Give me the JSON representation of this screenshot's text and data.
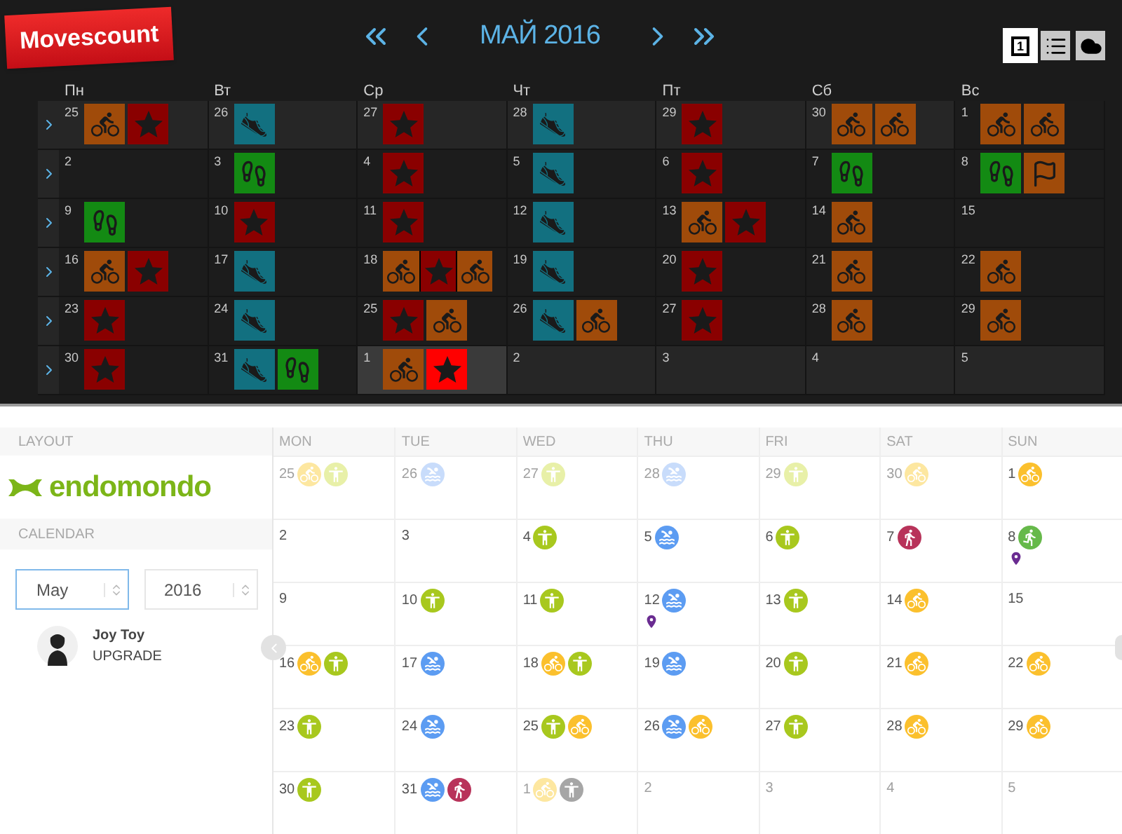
{
  "movescount": {
    "logo": "Movescount",
    "title": "МАЙ 2016",
    "views": [
      {
        "kind": "day",
        "label": "1",
        "selected": true
      },
      {
        "kind": "list",
        "selected": false
      },
      {
        "kind": "cloud",
        "selected": false
      }
    ],
    "weekdays": [
      "Пн",
      "Вт",
      "Ср",
      "Чт",
      "Пт",
      "Сб",
      "Вс"
    ],
    "weeks": [
      [
        {
          "day": "25",
          "kind": "other",
          "activities": [
            {
              "kind": "bike",
              "color": "#a04b0a"
            },
            {
              "kind": "star",
              "color": "#8a0000"
            }
          ]
        },
        {
          "day": "26",
          "kind": "other",
          "activities": [
            {
              "kind": "shoe",
              "color": "#127080"
            }
          ]
        },
        {
          "day": "27",
          "kind": "other",
          "activities": [
            {
              "kind": "star",
              "color": "#8a0000"
            }
          ]
        },
        {
          "day": "28",
          "kind": "other",
          "activities": [
            {
              "kind": "shoe",
              "color": "#127080"
            }
          ]
        },
        {
          "day": "29",
          "kind": "other",
          "activities": [
            {
              "kind": "star",
              "color": "#8a0000"
            }
          ]
        },
        {
          "day": "30",
          "kind": "other",
          "activities": [
            {
              "kind": "bike",
              "color": "#a04b0a"
            },
            {
              "kind": "bike",
              "color": "#a04b0a"
            }
          ]
        },
        {
          "day": "1",
          "kind": "current",
          "activities": [
            {
              "kind": "bike",
              "color": "#a04b0a"
            },
            {
              "kind": "bike",
              "color": "#a04b0a"
            }
          ]
        }
      ],
      [
        {
          "day": "2",
          "kind": "current"
        },
        {
          "day": "3",
          "kind": "current",
          "activities": [
            {
              "kind": "sole",
              "color": "#138a13"
            }
          ]
        },
        {
          "day": "4",
          "kind": "current",
          "activities": [
            {
              "kind": "star",
              "color": "#8a0000"
            }
          ]
        },
        {
          "day": "5",
          "kind": "current",
          "activities": [
            {
              "kind": "shoe",
              "color": "#127080"
            }
          ]
        },
        {
          "day": "6",
          "kind": "current",
          "activities": [
            {
              "kind": "star",
              "color": "#8a0000"
            }
          ]
        },
        {
          "day": "7",
          "kind": "current",
          "activities": [
            {
              "kind": "sole",
              "color": "#138a13"
            }
          ]
        },
        {
          "day": "8",
          "kind": "current",
          "activities": [
            {
              "kind": "sole",
              "color": "#138a13"
            },
            {
              "kind": "flag",
              "color": "#a04b0a"
            }
          ]
        }
      ],
      [
        {
          "day": "9",
          "kind": "current",
          "activities": [
            {
              "kind": "sole",
              "color": "#138a13"
            }
          ]
        },
        {
          "day": "10",
          "kind": "current",
          "activities": [
            {
              "kind": "star",
              "color": "#8a0000"
            }
          ]
        },
        {
          "day": "11",
          "kind": "current",
          "activities": [
            {
              "kind": "star",
              "color": "#8a0000"
            }
          ]
        },
        {
          "day": "12",
          "kind": "current",
          "activities": [
            {
              "kind": "shoe",
              "color": "#127080"
            }
          ]
        },
        {
          "day": "13",
          "kind": "current",
          "activities": [
            {
              "kind": "bike",
              "color": "#a04b0a"
            },
            {
              "kind": "star",
              "color": "#8a0000"
            }
          ]
        },
        {
          "day": "14",
          "kind": "current",
          "activities": [
            {
              "kind": "bike",
              "color": "#a04b0a"
            }
          ]
        },
        {
          "day": "15",
          "kind": "current"
        }
      ],
      [
        {
          "day": "16",
          "kind": "current",
          "activities": [
            {
              "kind": "bike",
              "color": "#a04b0a"
            },
            {
              "kind": "star",
              "color": "#8a0000"
            }
          ]
        },
        {
          "day": "17",
          "kind": "current",
          "activities": [
            {
              "kind": "shoe",
              "color": "#127080"
            }
          ]
        },
        {
          "day": "18",
          "kind": "current",
          "activities": [
            {
              "kind": "bike",
              "color": "#a04b0a"
            },
            {
              "kind": "star",
              "color": "#8a0000"
            },
            {
              "kind": "bike",
              "color": "#a04b0a"
            }
          ]
        },
        {
          "day": "19",
          "kind": "current",
          "activities": [
            {
              "kind": "shoe",
              "color": "#127080"
            }
          ]
        },
        {
          "day": "20",
          "kind": "current",
          "activities": [
            {
              "kind": "star",
              "color": "#8a0000"
            }
          ]
        },
        {
          "day": "21",
          "kind": "current",
          "activities": [
            {
              "kind": "bike",
              "color": "#a04b0a"
            }
          ]
        },
        {
          "day": "22",
          "kind": "current",
          "activities": [
            {
              "kind": "bike",
              "color": "#a04b0a"
            }
          ]
        }
      ],
      [
        {
          "day": "23",
          "kind": "current",
          "activities": [
            {
              "kind": "star",
              "color": "#8a0000"
            }
          ]
        },
        {
          "day": "24",
          "kind": "current",
          "activities": [
            {
              "kind": "shoe",
              "color": "#127080"
            }
          ]
        },
        {
          "day": "25",
          "kind": "current",
          "activities": [
            {
              "kind": "star",
              "color": "#8a0000"
            },
            {
              "kind": "bike",
              "color": "#a04b0a"
            }
          ]
        },
        {
          "day": "26",
          "kind": "current",
          "activities": [
            {
              "kind": "shoe",
              "color": "#127080"
            },
            {
              "kind": "bike",
              "color": "#a04b0a"
            }
          ]
        },
        {
          "day": "27",
          "kind": "current",
          "activities": [
            {
              "kind": "star",
              "color": "#8a0000"
            }
          ]
        },
        {
          "day": "28",
          "kind": "current",
          "activities": [
            {
              "kind": "bike",
              "color": "#a04b0a"
            }
          ]
        },
        {
          "day": "29",
          "kind": "current",
          "activities": [
            {
              "kind": "bike",
              "color": "#a04b0a"
            }
          ]
        }
      ],
      [
        {
          "day": "30",
          "kind": "current",
          "activities": [
            {
              "kind": "star",
              "color": "#8a0000"
            }
          ]
        },
        {
          "day": "31",
          "kind": "current",
          "activities": [
            {
              "kind": "shoe",
              "color": "#127080"
            },
            {
              "kind": "sole",
              "color": "#138a13"
            }
          ]
        },
        {
          "day": "1",
          "kind": "today",
          "activities": [
            {
              "kind": "bike",
              "color": "#a04b0a"
            },
            {
              "kind": "star",
              "color": "#ff0000"
            }
          ]
        },
        {
          "day": "2",
          "kind": "other"
        },
        {
          "day": "3",
          "kind": "other"
        },
        {
          "day": "4",
          "kind": "other"
        },
        {
          "day": "5",
          "kind": "other"
        }
      ]
    ]
  },
  "endomondo": {
    "sidebar": {
      "layout_heading": "LAYOUT",
      "logo": "endomondo",
      "calendar_heading": "CALENDAR",
      "month": "May",
      "year": "2016",
      "user": {
        "name": "Joy Toy",
        "action": "UPGRADE"
      }
    },
    "weekdays": [
      "MON",
      "TUE",
      "WED",
      "THU",
      "FRI",
      "SAT",
      "SUN"
    ],
    "weeks": [
      [
        {
          "day": "25",
          "other_month": true,
          "pin": false,
          "activities": [
            {
              "kind": "bike",
              "color": "#fde7a0"
            },
            {
              "kind": "fitness",
              "color": "#e8f0a8"
            }
          ]
        },
        {
          "day": "26",
          "other_month": true,
          "pin": false,
          "activities": [
            {
              "kind": "swim",
              "color": "#c8dcfb"
            }
          ]
        },
        {
          "day": "27",
          "other_month": true,
          "pin": false,
          "activities": [
            {
              "kind": "fitness",
              "color": "#e8f0a8"
            }
          ]
        },
        {
          "day": "28",
          "other_month": true,
          "pin": false,
          "activities": [
            {
              "kind": "swim",
              "color": "#c8dcfb"
            }
          ]
        },
        {
          "day": "29",
          "other_month": true,
          "pin": false,
          "activities": [
            {
              "kind": "fitness",
              "color": "#e8f0a8"
            }
          ]
        },
        {
          "day": "30",
          "other_month": true,
          "pin": false,
          "activities": [
            {
              "kind": "bike",
              "color": "#fde7a0"
            }
          ]
        },
        {
          "day": "1",
          "other_month": false,
          "pin": false,
          "activities": [
            {
              "kind": "bike",
              "color": "#fbc02d"
            }
          ]
        }
      ],
      [
        {
          "day": "2",
          "other_month": false,
          "pin": false
        },
        {
          "day": "3",
          "other_month": false,
          "pin": false
        },
        {
          "day": "4",
          "other_month": false,
          "pin": false,
          "activities": [
            {
              "kind": "fitness",
              "color": "#a8c81e"
            }
          ]
        },
        {
          "day": "5",
          "other_month": false,
          "pin": false,
          "activities": [
            {
              "kind": "swim",
              "color": "#5c9cf2"
            }
          ]
        },
        {
          "day": "6",
          "other_month": false,
          "pin": false,
          "activities": [
            {
              "kind": "fitness",
              "color": "#a8c81e"
            }
          ]
        },
        {
          "day": "7",
          "other_month": false,
          "pin": false,
          "activities": [
            {
              "kind": "walk",
              "color": "#b8335a"
            }
          ]
        },
        {
          "day": "8",
          "other_month": false,
          "pin": true,
          "activities": [
            {
              "kind": "run",
              "color": "#66b94a"
            }
          ]
        }
      ],
      [
        {
          "day": "9",
          "other_month": false,
          "pin": false
        },
        {
          "day": "10",
          "other_month": false,
          "pin": false,
          "activities": [
            {
              "kind": "fitness",
              "color": "#a8c81e"
            }
          ]
        },
        {
          "day": "11",
          "other_month": false,
          "pin": false,
          "activities": [
            {
              "kind": "fitness",
              "color": "#a8c81e"
            }
          ]
        },
        {
          "day": "12",
          "other_month": false,
          "pin": true,
          "activities": [
            {
              "kind": "swim",
              "color": "#5c9cf2"
            }
          ]
        },
        {
          "day": "13",
          "other_month": false,
          "pin": false,
          "activities": [
            {
              "kind": "fitness",
              "color": "#a8c81e"
            }
          ]
        },
        {
          "day": "14",
          "other_month": false,
          "pin": false,
          "activities": [
            {
              "kind": "bike",
              "color": "#fbc02d"
            }
          ]
        },
        {
          "day": "15",
          "other_month": false,
          "pin": false
        }
      ],
      [
        {
          "day": "16",
          "other_month": false,
          "pin": false,
          "activities": [
            {
              "kind": "bike",
              "color": "#fbc02d"
            },
            {
              "kind": "fitness",
              "color": "#a8c81e"
            }
          ]
        },
        {
          "day": "17",
          "other_month": false,
          "pin": false,
          "activities": [
            {
              "kind": "swim",
              "color": "#5c9cf2"
            }
          ]
        },
        {
          "day": "18",
          "other_month": false,
          "pin": false,
          "activities": [
            {
              "kind": "bike",
              "color": "#fbc02d"
            },
            {
              "kind": "fitness",
              "color": "#a8c81e"
            }
          ]
        },
        {
          "day": "19",
          "other_month": false,
          "pin": false,
          "activities": [
            {
              "kind": "swim",
              "color": "#5c9cf2"
            }
          ]
        },
        {
          "day": "20",
          "other_month": false,
          "pin": false,
          "activities": [
            {
              "kind": "fitness",
              "color": "#a8c81e"
            }
          ]
        },
        {
          "day": "21",
          "other_month": false,
          "pin": false,
          "activities": [
            {
              "kind": "bike",
              "color": "#fbc02d"
            }
          ]
        },
        {
          "day": "22",
          "other_month": false,
          "pin": false,
          "activities": [
            {
              "kind": "bike",
              "color": "#fbc02d"
            }
          ]
        }
      ],
      [
        {
          "day": "23",
          "other_month": false,
          "pin": false,
          "activities": [
            {
              "kind": "fitness",
              "color": "#a8c81e"
            }
          ]
        },
        {
          "day": "24",
          "other_month": false,
          "pin": false,
          "activities": [
            {
              "kind": "swim",
              "color": "#5c9cf2"
            }
          ]
        },
        {
          "day": "25",
          "other_month": false,
          "pin": false,
          "activities": [
            {
              "kind": "fitness",
              "color": "#a8c81e"
            },
            {
              "kind": "bike",
              "color": "#fbc02d"
            }
          ]
        },
        {
          "day": "26",
          "other_month": false,
          "pin": false,
          "activities": [
            {
              "kind": "swim",
              "color": "#5c9cf2"
            },
            {
              "kind": "bike",
              "color": "#fbc02d"
            }
          ]
        },
        {
          "day": "27",
          "other_month": false,
          "pin": false,
          "activities": [
            {
              "kind": "fitness",
              "color": "#a8c81e"
            }
          ]
        },
        {
          "day": "28",
          "other_month": false,
          "pin": false,
          "activities": [
            {
              "kind": "bike",
              "color": "#fbc02d"
            }
          ]
        },
        {
          "day": "29",
          "other_month": false,
          "pin": false,
          "activities": [
            {
              "kind": "bike",
              "color": "#fbc02d"
            }
          ]
        }
      ],
      [
        {
          "day": "30",
          "other_month": false,
          "pin": false,
          "activities": [
            {
              "kind": "fitness",
              "color": "#a8c81e"
            }
          ]
        },
        {
          "day": "31",
          "other_month": false,
          "pin": false,
          "activities": [
            {
              "kind": "swim",
              "color": "#5c9cf2"
            },
            {
              "kind": "walk",
              "color": "#b8335a"
            }
          ]
        },
        {
          "day": "1",
          "other_month": true,
          "pin": false,
          "activities": [
            {
              "kind": "bike",
              "color": "#fde7a0"
            },
            {
              "kind": "fitness",
              "color": "#a6a6a6"
            }
          ]
        },
        {
          "day": "2",
          "other_month": true,
          "pin": false
        },
        {
          "day": "3",
          "other_month": true,
          "pin": false
        },
        {
          "day": "4",
          "other_month": true,
          "pin": false
        },
        {
          "day": "5",
          "other_month": true,
          "pin": false
        }
      ]
    ]
  }
}
